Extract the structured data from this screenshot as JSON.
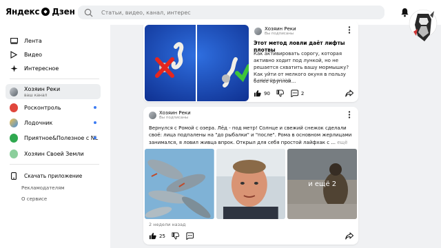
{
  "header": {
    "logo_text": "Яндекс",
    "logo_text2": "Дзен",
    "search_placeholder": "Статьи, видео, канал, интерес"
  },
  "sidebar": {
    "nav": [
      {
        "label": "Лента",
        "icon": "feed-icon"
      },
      {
        "label": "Видео",
        "icon": "play-icon"
      },
      {
        "label": "Интересное",
        "icon": "sparkle-icon"
      }
    ],
    "my_channel": {
      "label": "Хозяин Реки",
      "sub": "ваш канал"
    },
    "channels": [
      {
        "label": "Росконтроль",
        "color": "#e0463c",
        "dot": true
      },
      {
        "label": "Лодочник",
        "color": "#4a90d9",
        "dot": true
      },
      {
        "label": "Приятное&Полезное с NL",
        "color": "#2fa84f",
        "dot": true
      },
      {
        "label": "Хозяин Своей Земли",
        "color": "#8ccf9c",
        "dot": false
      }
    ],
    "app_label": "Скачать приложение",
    "ads_label": "Рекламодателям",
    "about_label": "О сервисе"
  },
  "card1": {
    "author": "Хозяин Реки",
    "author_sub": "Вы подписаны",
    "title": "Этот метод ловли даёт лифты плотвы",
    "text": "Как активировать сорогу, которая активно ходит под лункой, но не решается схватить вашу мормышку? Как уйти от мелкого окуня в пользу более крупной...",
    "date": "2 недели назад",
    "likes": "90",
    "comments": "2"
  },
  "card2": {
    "author": "Хозяин Реки",
    "author_sub": "Вы подписаны",
    "text": "Вернулся с Ромой с озера. Лёд - под метр! Солнце и свежий снежок сделали своё: лица подпалены на \"до рыбалки\" и \"после\". Рома в основном жерлицами занимался, я ловил живца впрок. Открыл для себя простой лайфхак с ...",
    "more": "ещё",
    "more_photos": "и ещё 2",
    "date": "2 недели назад",
    "likes": "25"
  },
  "colors": {
    "accent": "#3d7cf2",
    "background": "#f0f1f3"
  }
}
